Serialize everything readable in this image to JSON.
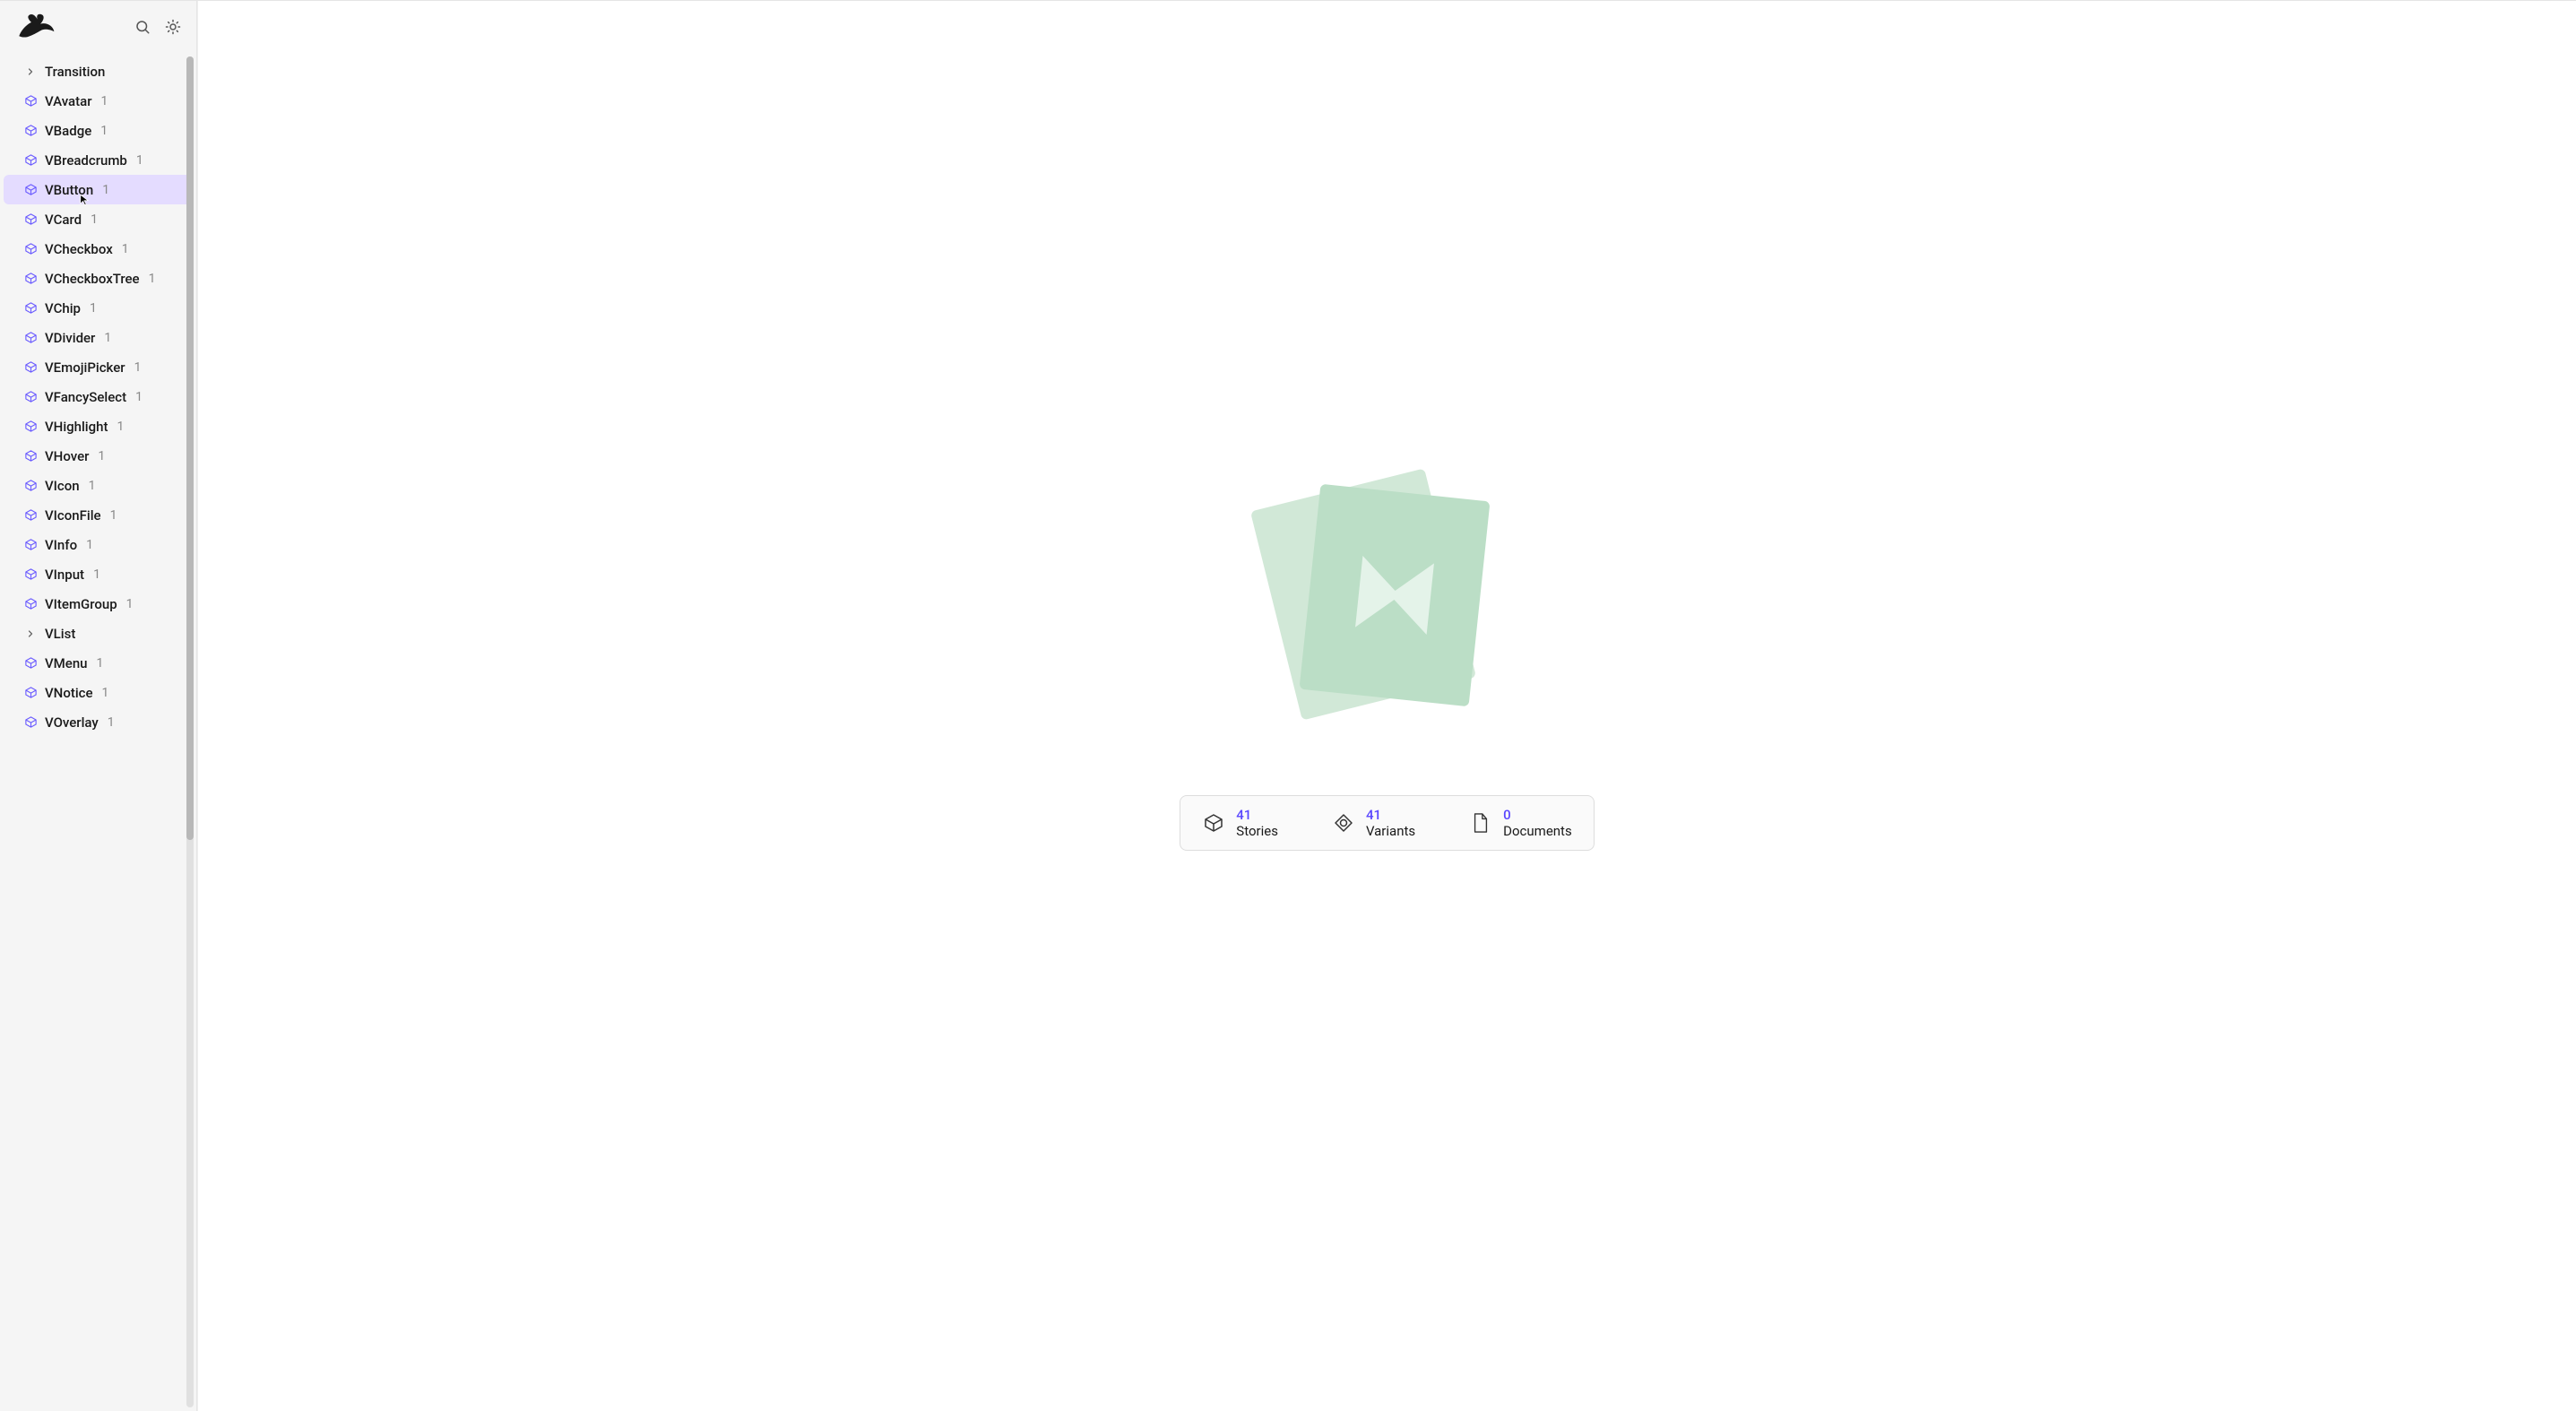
{
  "colors": {
    "accent": "#5946ff",
    "sidebarSelected": "#e4dcff",
    "iconPurple": "#6b5cff",
    "illustrationBack": "#d1e8d7",
    "illustrationFront": "#bbdec6",
    "illustrationIcon": "#e4f3e9"
  },
  "sidebar": {
    "items": [
      {
        "label": "Transition",
        "count": "",
        "icon": "chevron",
        "selected": false
      },
      {
        "label": "VAvatar",
        "count": "1",
        "icon": "box",
        "selected": false
      },
      {
        "label": "VBadge",
        "count": "1",
        "icon": "box",
        "selected": false
      },
      {
        "label": "VBreadcrumb",
        "count": "1",
        "icon": "box",
        "selected": false
      },
      {
        "label": "VButton",
        "count": "1",
        "icon": "box",
        "selected": true
      },
      {
        "label": "VCard",
        "count": "1",
        "icon": "box",
        "selected": false
      },
      {
        "label": "VCheckbox",
        "count": "1",
        "icon": "box",
        "selected": false
      },
      {
        "label": "VCheckboxTree",
        "count": "1",
        "icon": "box",
        "selected": false
      },
      {
        "label": "VChip",
        "count": "1",
        "icon": "box",
        "selected": false
      },
      {
        "label": "VDivider",
        "count": "1",
        "icon": "box",
        "selected": false
      },
      {
        "label": "VEmojiPicker",
        "count": "1",
        "icon": "box",
        "selected": false
      },
      {
        "label": "VFancySelect",
        "count": "1",
        "icon": "box",
        "selected": false
      },
      {
        "label": "VHighlight",
        "count": "1",
        "icon": "box",
        "selected": false
      },
      {
        "label": "VHover",
        "count": "1",
        "icon": "box",
        "selected": false
      },
      {
        "label": "VIcon",
        "count": "1",
        "icon": "box",
        "selected": false
      },
      {
        "label": "VIconFile",
        "count": "1",
        "icon": "box",
        "selected": false
      },
      {
        "label": "VInfo",
        "count": "1",
        "icon": "box",
        "selected": false
      },
      {
        "label": "VInput",
        "count": "1",
        "icon": "box",
        "selected": false
      },
      {
        "label": "VItemGroup",
        "count": "1",
        "icon": "box",
        "selected": false
      },
      {
        "label": "VList",
        "count": "",
        "icon": "chevron",
        "selected": false
      },
      {
        "label": "VMenu",
        "count": "1",
        "icon": "box",
        "selected": false
      },
      {
        "label": "VNotice",
        "count": "1",
        "icon": "box",
        "selected": false
      },
      {
        "label": "VOverlay",
        "count": "1",
        "icon": "box",
        "selected": false
      }
    ]
  },
  "stats": {
    "stories": {
      "value": "41",
      "label": "Stories"
    },
    "variants": {
      "value": "41",
      "label": "Variants"
    },
    "documents": {
      "value": "0",
      "label": "Documents"
    }
  }
}
